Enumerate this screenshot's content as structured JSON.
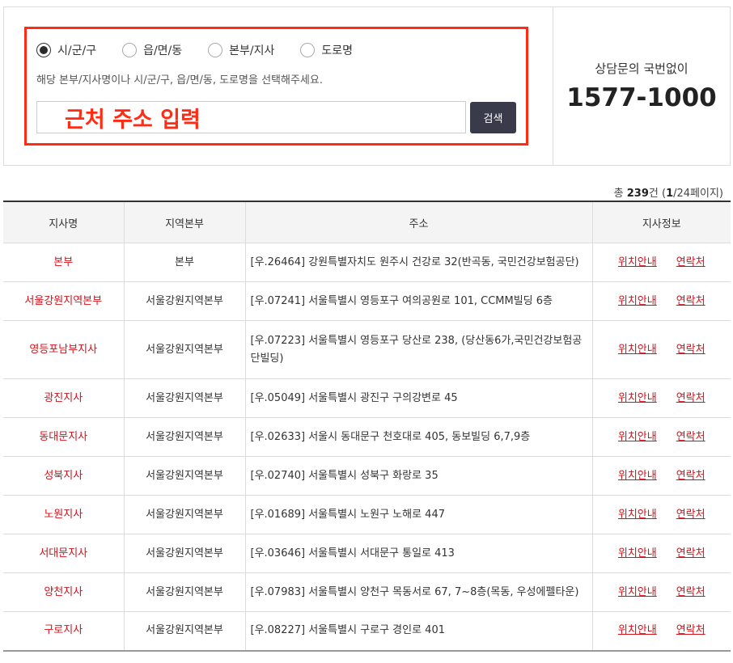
{
  "search": {
    "radios": [
      {
        "label": "시/군/구",
        "checked": true
      },
      {
        "label": "읍/면/동",
        "checked": false
      },
      {
        "label": "본부/지사",
        "checked": false
      },
      {
        "label": "도로명",
        "checked": false
      }
    ],
    "hint": "해당 본부/지사명이나 시/군/구, 읍/면/동, 도로명을 선택해주세요.",
    "input_value": "근처 주소 입력",
    "button_label": "검색",
    "highlight_color": "#ff2b12"
  },
  "contact": {
    "label": "상담문의 국번없이",
    "number": "1577-1000"
  },
  "summary": {
    "prefix": "총 ",
    "count": "239",
    "count_suffix": "건 (",
    "page": "1",
    "pages": "/24페이지)"
  },
  "table": {
    "headers": [
      "지사명",
      "지역본부",
      "주소",
      "지사정보"
    ],
    "link_labels": [
      "위치안내",
      "연락처"
    ],
    "rows": [
      {
        "name": "본부",
        "region": "본부",
        "address": "[우.26464] 강원특별자치도 원주시 건강로 32(반곡동, 국민건강보험공단)"
      },
      {
        "name": "서울강원지역본부",
        "region": "서울강원지역본부",
        "address": "[우.07241] 서울특별시 영등포구 여의공원로 101, CCMM빌딩 6층"
      },
      {
        "name": "영등포남부지사",
        "region": "서울강원지역본부",
        "address": "[우.07223] 서울특별시 영등포구 당산로 238, (당산동6가,국민건강보험공단빌딩)"
      },
      {
        "name": "광진지사",
        "region": "서울강원지역본부",
        "address": "[우.05049] 서울특별시 광진구 구의강변로 45"
      },
      {
        "name": "동대문지사",
        "region": "서울강원지역본부",
        "address": "[우.02633] 서울시 동대문구 천호대로 405, 동보빌딩 6,7,9층"
      },
      {
        "name": "성북지사",
        "region": "서울강원지역본부",
        "address": "[우.02740] 서울특별시 성북구 화랑로 35"
      },
      {
        "name": "노원지사",
        "region": "서울강원지역본부",
        "address": "[우.01689] 서울특별시 노원구 노해로 447"
      },
      {
        "name": "서대문지사",
        "region": "서울강원지역본부",
        "address": "[우.03646] 서울특별시 서대문구 통일로 413"
      },
      {
        "name": "양천지사",
        "region": "서울강원지역본부",
        "address": "[우.07983] 서울특별시 양천구 목동서로 67, 7~8층(목동, 우성에펠타운)"
      },
      {
        "name": "구로지사",
        "region": "서울강원지역본부",
        "address": "[우.08227] 서울특별시 구로구 경인로 401"
      }
    ]
  },
  "colors": {
    "accent_red": "#d4111a",
    "button_dark": "#3a3b4a"
  }
}
